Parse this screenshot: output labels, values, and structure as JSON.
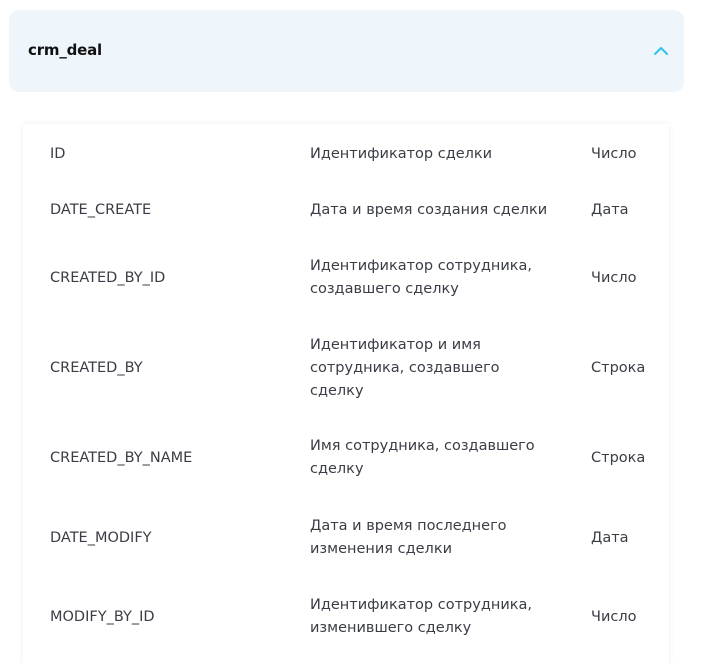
{
  "accordion": {
    "title": "crm_deal",
    "accent_color": "#2ec4e6",
    "header_bg": "#eef6fc",
    "icon": "chevron-up-icon"
  },
  "table": {
    "rows": [
      {
        "field": "ID",
        "description": "Идентификатор сделки",
        "type": "Число"
      },
      {
        "field": "DATE_CREATE",
        "description": "Дата и время создания сделки",
        "type": "Дата"
      },
      {
        "field": "CREATED_BY_ID",
        "description": "Идентификатор сотрудника, создавшего сделку",
        "type": "Число"
      },
      {
        "field": "CREATED_BY",
        "description": "Идентификатор и имя сотрудника, создавшего сделку",
        "type": "Строка"
      },
      {
        "field": "CREATED_BY_NAME",
        "description": "Имя сотрудника, создавшего сделку",
        "type": "Строка"
      },
      {
        "field": "DATE_MODIFY",
        "description": "Дата и время последнего изменения сделки",
        "type": "Дата"
      },
      {
        "field": "MODIFY_BY_ID",
        "description": "Идентификатор сотрудника, изменившего сделку",
        "type": "Число"
      }
    ]
  }
}
